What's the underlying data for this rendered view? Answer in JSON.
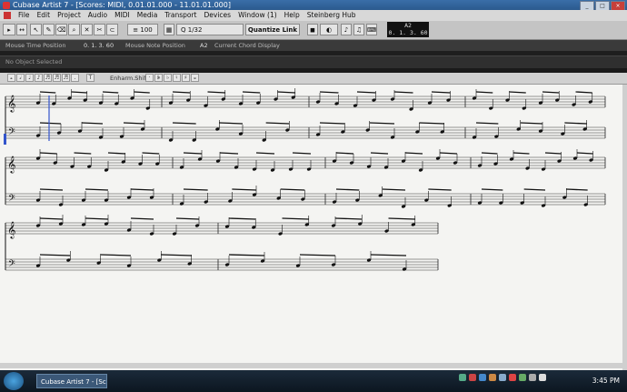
{
  "window": {
    "title": "Cubase Artist 7 - [Scores: MIDI, 0.01.01.000 - 11.01.01.000]"
  },
  "menu": [
    "File",
    "Edit",
    "Project",
    "Audio",
    "MIDI",
    "Media",
    "Transport",
    "Devices",
    "Window (1)",
    "Help",
    "Steinberg Hub"
  ],
  "toolbar": {
    "velocity_label": "100",
    "quantize_value": "1/32",
    "quantize_preset": "Quantize Link"
  },
  "time_display": {
    "note": "A2",
    "position": "0. 1. 3. 60"
  },
  "info_line": {
    "mouse_time_label": "Mouse Time Position",
    "mouse_time_value": "0. 1. 3. 60",
    "mouse_note_label": "Mouse Note Position",
    "mouse_note_value": "A2",
    "chord_label": "Current Chord Display"
  },
  "object_bar": {
    "text": "No Object Selected"
  },
  "score_toolbar": {
    "enharm_label": "Enharm.Shift"
  },
  "taskbar": {
    "task_label": "Cubase Artist 7 - [Sc...",
    "clock": "3:45 PM"
  },
  "colors": {
    "titlebar": "#2b5a8e",
    "score_bg": "#f4f4f2",
    "playhead": "#3355cc"
  }
}
